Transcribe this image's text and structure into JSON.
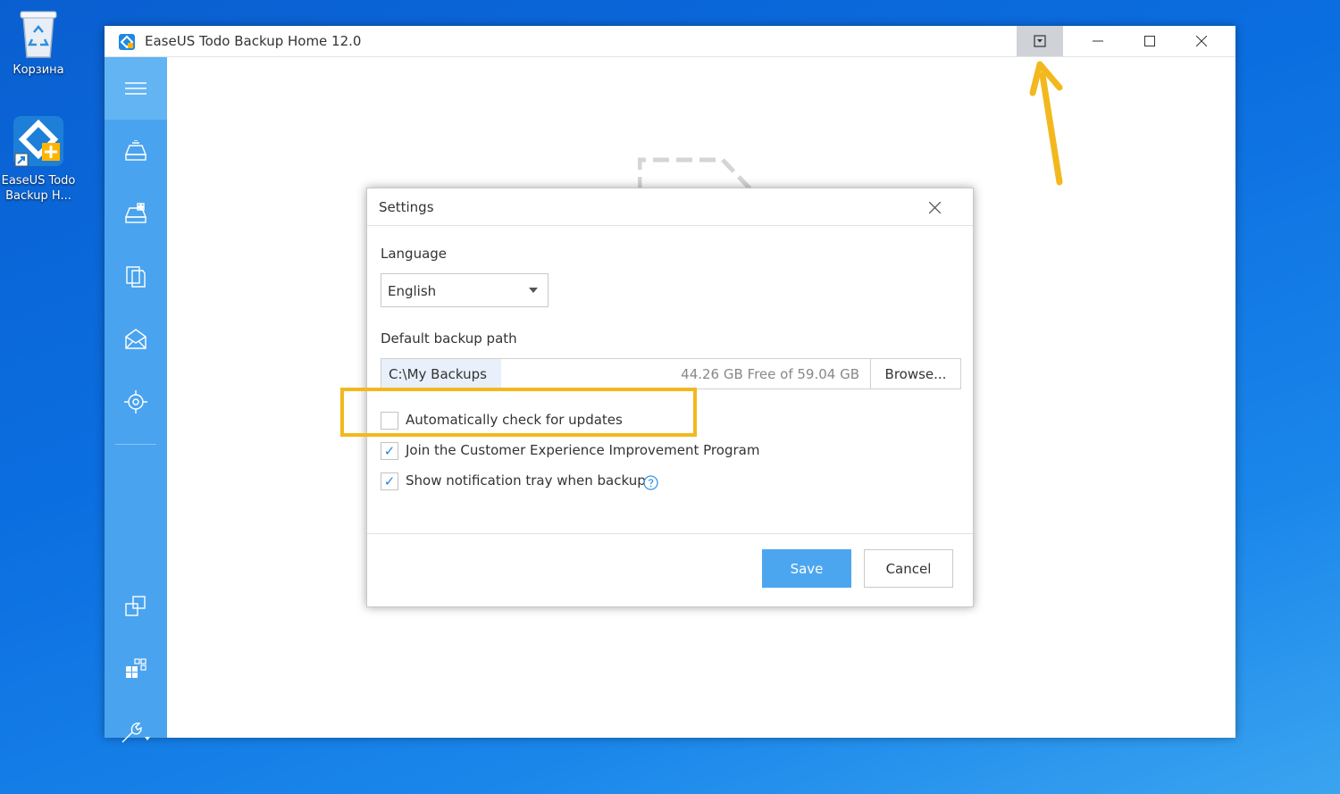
{
  "desktop": {
    "icons": [
      {
        "label": "Корзина"
      },
      {
        "label": "EaseUS Todo Backup H..."
      }
    ]
  },
  "window": {
    "title": "EaseUS Todo Backup Home 12.0",
    "controls": {
      "menu": "menu-dropdown",
      "minimize": "—",
      "maximize": "☐",
      "close": "✕"
    }
  },
  "sidebar": {
    "items": [
      {
        "icon": "menu-icon"
      },
      {
        "icon": "disk-backup-icon"
      },
      {
        "icon": "system-backup-icon"
      },
      {
        "icon": "file-backup-icon"
      },
      {
        "icon": "mail-backup-icon"
      },
      {
        "icon": "smart-backup-icon"
      },
      {
        "icon": "clone-icon"
      },
      {
        "icon": "system-transfer-icon"
      },
      {
        "icon": "tools-icon"
      }
    ]
  },
  "dialog": {
    "title": "Settings",
    "language_label": "Language",
    "language_value": "English",
    "path_label": "Default backup path",
    "path_value": "C:\\My Backups",
    "path_free": "44.26 GB Free of 59.04 GB",
    "browse_label": "Browse...",
    "options": [
      {
        "label": "Automatically check for updates",
        "checked": false
      },
      {
        "label": "Join the Customer Experience Improvement Program",
        "checked": true
      },
      {
        "label": "Show notification tray when backup",
        "checked": true
      }
    ],
    "check_mark": "✓",
    "save_label": "Save",
    "cancel_label": "Cancel"
  },
  "colors": {
    "accent": "#4ca6ef",
    "sidebar": "#4aa3ee",
    "highlight": "#f2b81d",
    "arrow": "#f2b81d"
  }
}
